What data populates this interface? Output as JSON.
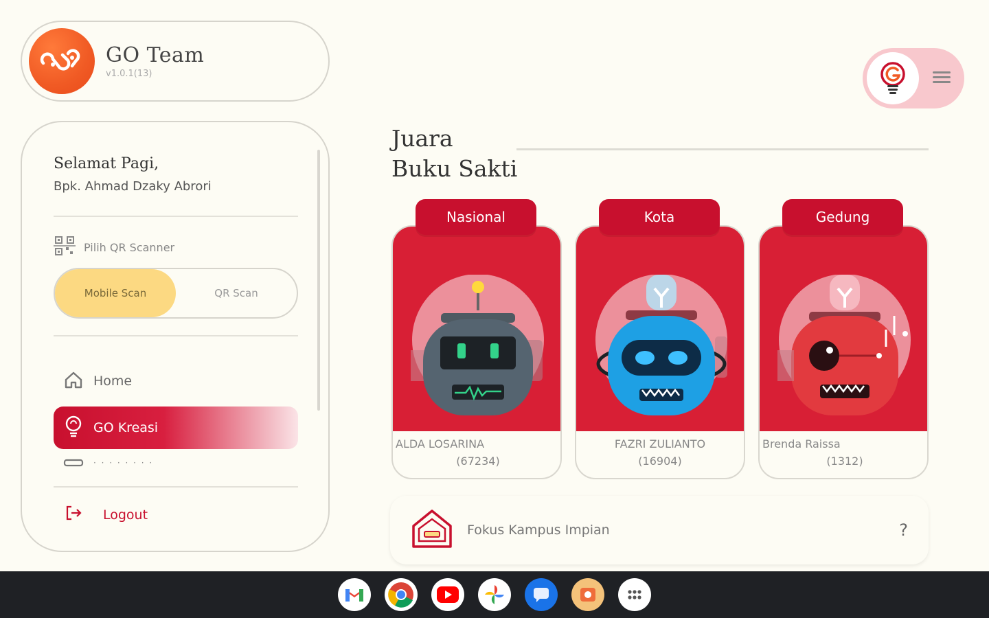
{
  "app": {
    "name": "GO Team",
    "version": "v1.0.1(13)"
  },
  "sidebar": {
    "greeting": "Selamat Pagi,",
    "user": "Bpk. Ahmad Dzaky Abrori",
    "qr_label": "Pilih QR Scanner",
    "scan_options": [
      "Mobile Scan",
      "QR Scan"
    ],
    "selected_scan": "Mobile Scan",
    "nav": [
      {
        "label": "Home",
        "icon": "home-icon",
        "active": false
      },
      {
        "label": "GO Kreasi",
        "icon": "bulb-icon",
        "active": true
      },
      {
        "label": "· · · · · · · ·",
        "icon": "card-icon",
        "active": false
      }
    ],
    "logout": "Logout"
  },
  "section": {
    "title_line1": "Juara",
    "title_line2": "Buku Sakti"
  },
  "leaderboard": [
    {
      "tab": "Nasional",
      "name": "ALDA LOSARINA",
      "score": "(67234)",
      "robot": "gray"
    },
    {
      "tab": "Kota",
      "name": "FAZRI ZULIANTO",
      "score": "(16904)",
      "robot": "blue"
    },
    {
      "tab": "Gedung",
      "name": "Brenda Raissa",
      "score": "(1312)",
      "robot": "red"
    }
  ],
  "fokus": {
    "label": "Fokus Kampus Impian",
    "help": "?"
  },
  "colors": {
    "primary": "#c8102e",
    "accent": "#fcd982",
    "background": "#fdfcf4"
  },
  "taskbar": [
    "gmail-icon",
    "chrome-icon",
    "youtube-icon",
    "photos-icon",
    "messages-icon",
    "gallery-icon",
    "apps-icon"
  ]
}
